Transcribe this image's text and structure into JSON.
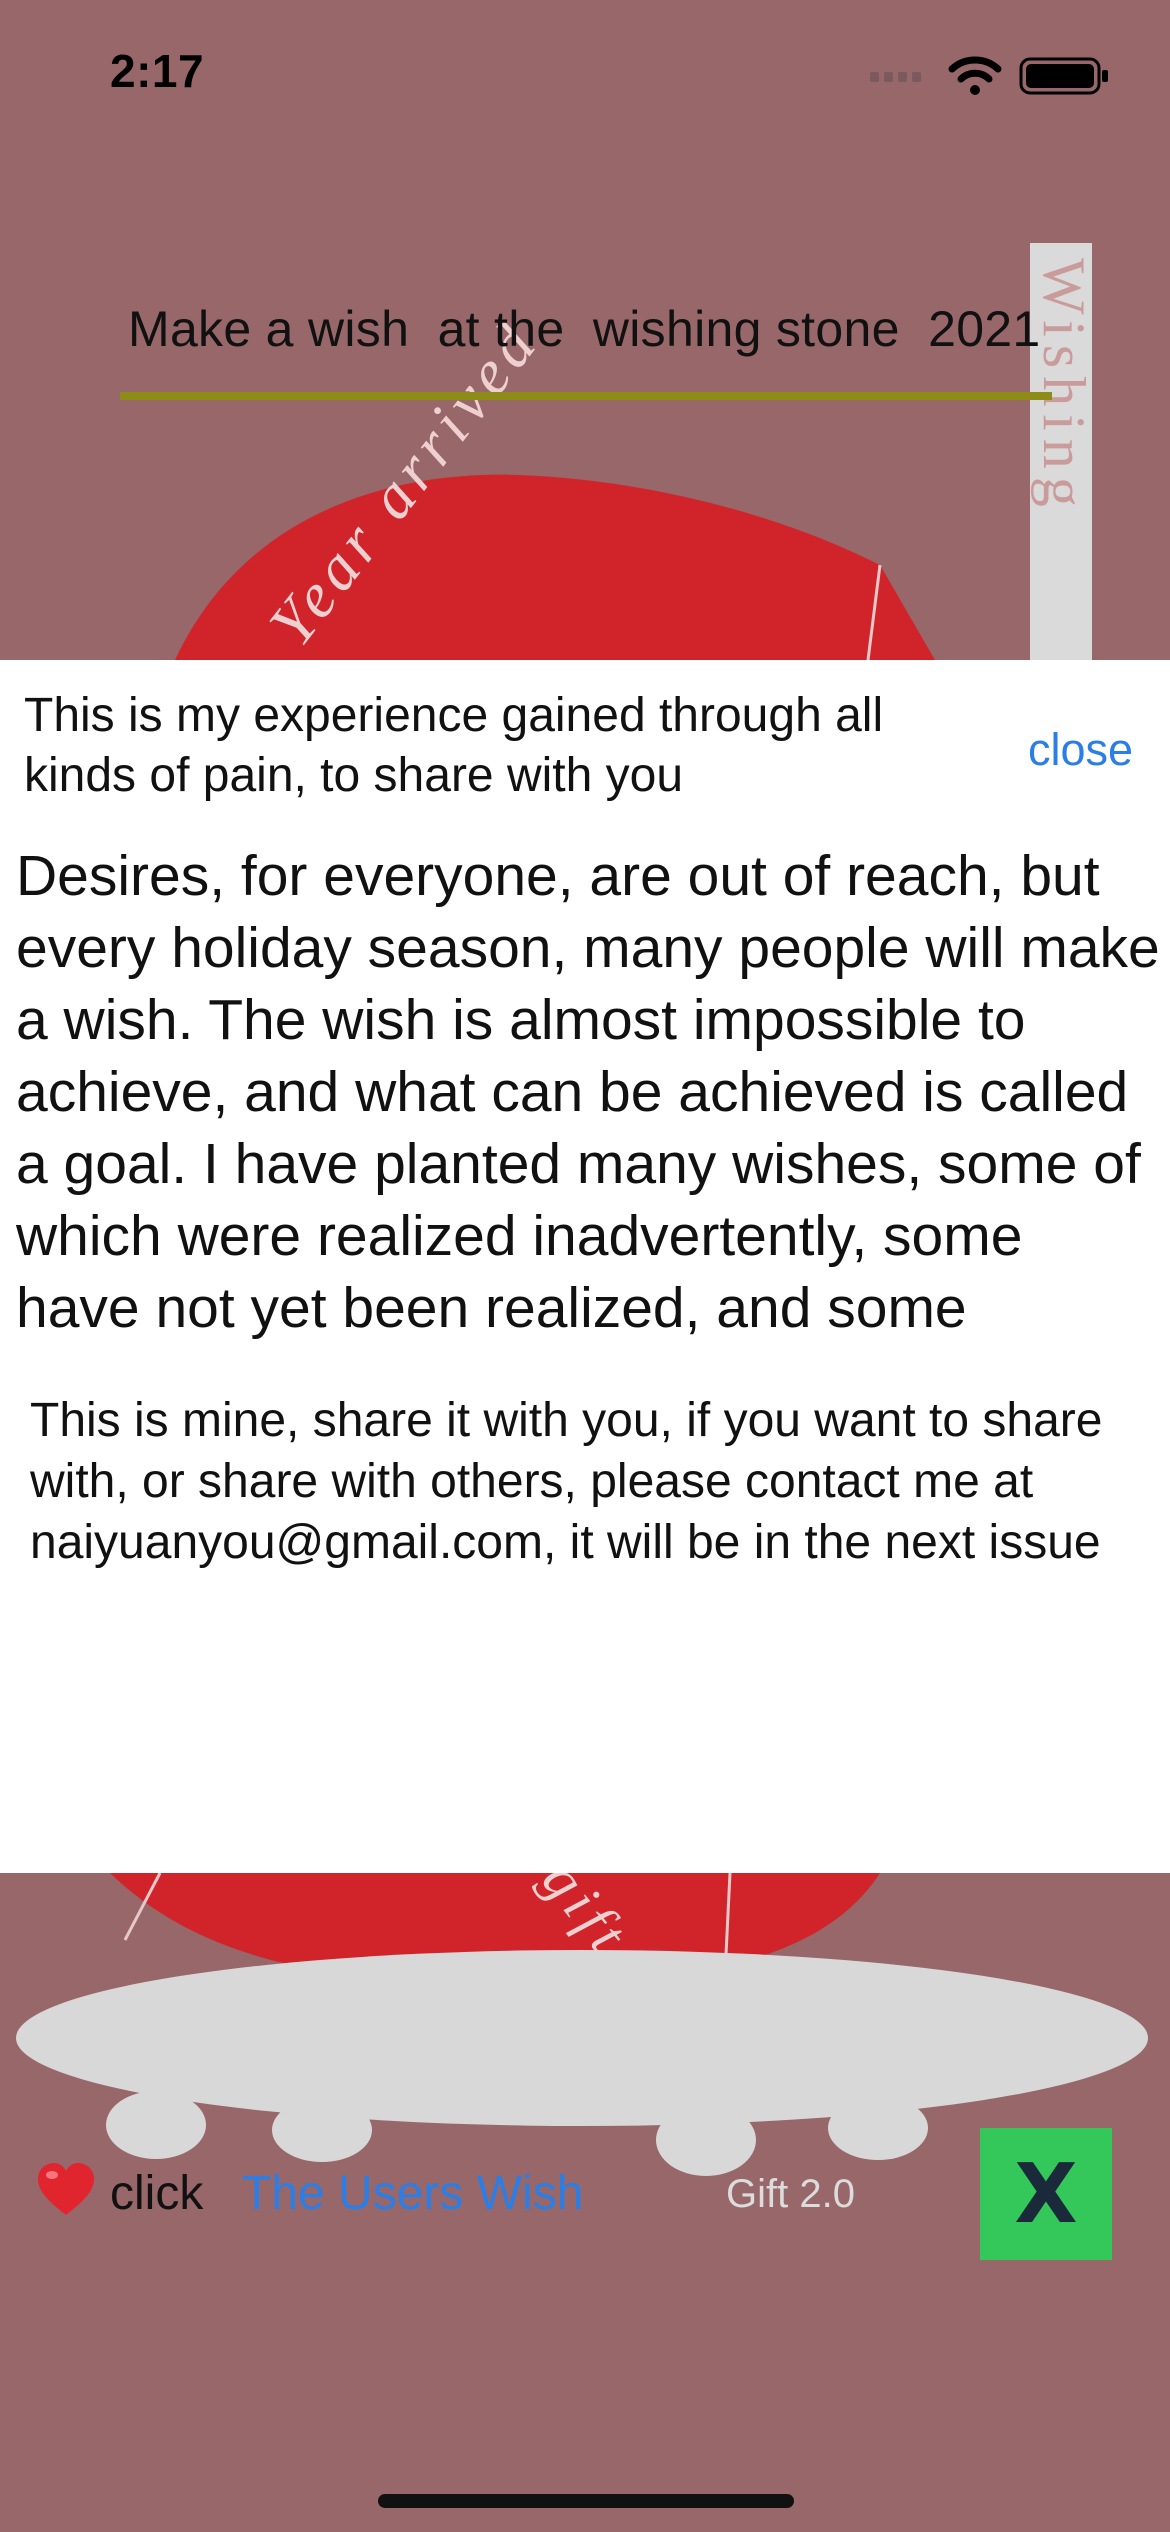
{
  "status_bar": {
    "time": "2:17"
  },
  "background": {
    "title": "Make a wish  at the  wishing stone  2021",
    "stone_text_top": "Year arrived",
    "stone_text_side": "Wishing",
    "stone_text_bottom": "gift",
    "colors": {
      "background": "#98676a",
      "stone": "#d0242a",
      "underline": "#8c8c16"
    }
  },
  "sheet": {
    "intro": "This is my experience gained through all kinds of pain, to share with you",
    "close_label": "close",
    "article": "Desires, for everyone, are out of reach, but every holiday season, many people will make a wish. The wish is almost impossible to achieve, and what can be achieved is called a goal. I have planted many wishes, some of which were realized inadvertently, some have not yet been realized, and some",
    "share_note": "This is mine, share it with you, if you want to share with, or share with others, please contact me at naiyuanyou@gmail.com, it will be in the next issue"
  },
  "bottom_bar": {
    "heart_icon": "heart-icon",
    "click_label": "click",
    "users_wish_link": "The Users Wish",
    "version": "Gift 2.0",
    "close_x_label": "X",
    "accent_link": "#2a7ee6",
    "close_button_color": "#34c759"
  }
}
